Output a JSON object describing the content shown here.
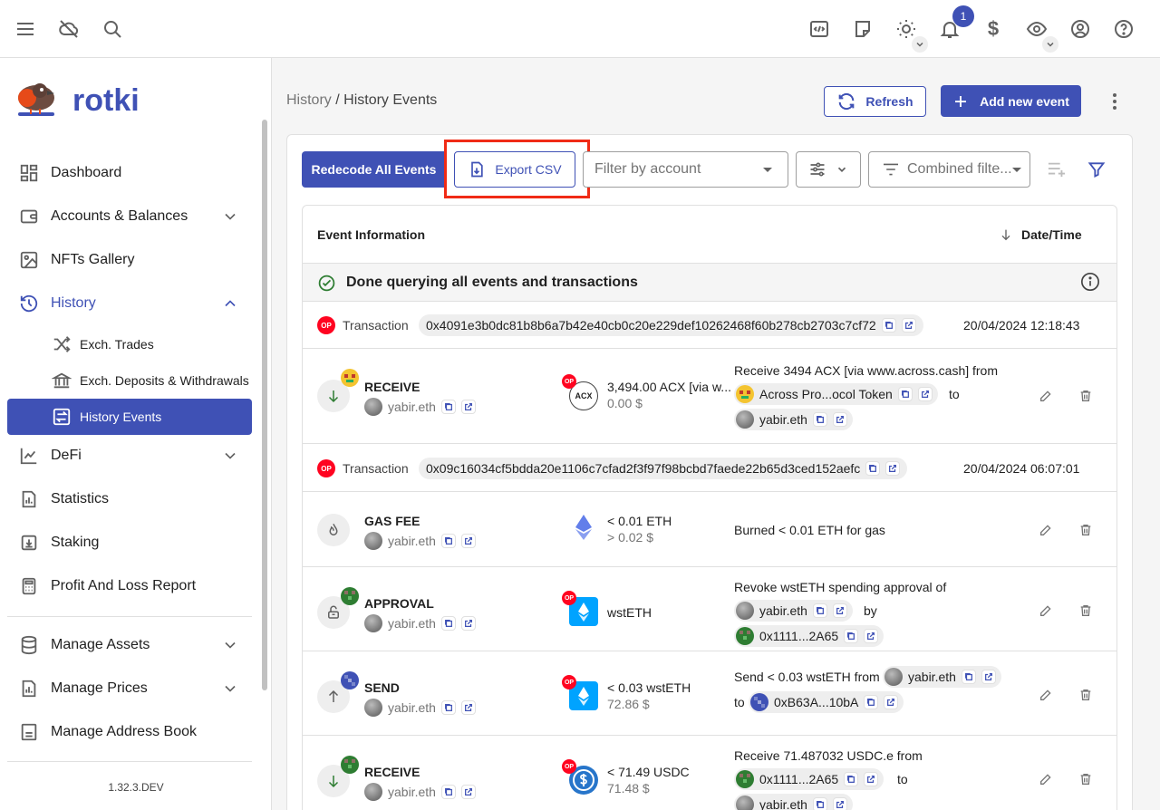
{
  "topbar": {
    "notification_count": "1",
    "currency_symbol": "$",
    "icons": [
      "menu-icon",
      "cloud-off-icon",
      "search-icon",
      "code-icon",
      "note-icon",
      "sun-icon",
      "bell-icon",
      "currency-icon",
      "eye-icon",
      "account-icon",
      "help-icon"
    ]
  },
  "sidebar": {
    "brand": "rotki",
    "items": [
      {
        "label": "Dashboard"
      },
      {
        "label": "Accounts & Balances"
      },
      {
        "label": "NFTs Gallery"
      },
      {
        "label": "History"
      },
      {
        "label": "Exch. Trades"
      },
      {
        "label": "Exch. Deposits & Withdrawals"
      },
      {
        "label": "History Events"
      },
      {
        "label": "DeFi"
      },
      {
        "label": "Statistics"
      },
      {
        "label": "Staking"
      },
      {
        "label": "Profit And Loss Report"
      },
      {
        "label": "Manage Assets"
      },
      {
        "label": "Manage Prices"
      },
      {
        "label": "Manage Address Book"
      }
    ],
    "version": "1.32.3.DEV"
  },
  "header": {
    "breadcrumb_root": "History",
    "breadcrumb_sep": "/",
    "breadcrumb_current": "History Events",
    "refresh_label": "Refresh",
    "add_label": "Add new event"
  },
  "toolbar": {
    "redecode_label": "Redecode All Events",
    "export_label": "Export CSV",
    "account_placeholder": "Filter by account",
    "combined_placeholder": "Combined filte..."
  },
  "table": {
    "col_event": "Event Information",
    "col_date": "Date/Time",
    "status": "Done querying all events and transactions",
    "transactions": [
      {
        "label": "Transaction",
        "chain": "OP",
        "hash": "0x4091e3b0dc81b8b6a7b42e40cb0c20e229def10262468f60b278cb2703c7cf72",
        "date": "20/04/2024 12:18:43",
        "events": [
          {
            "type": "RECEIVE",
            "account": "yabir.eth",
            "asset_symbol": "ACX",
            "amount": "3,494.00 ACX [via w...",
            "value": "0.00 $",
            "desc_prefix": "Receive 3494 ACX [via www.across.cash] from",
            "from_chip": "Across Pro...ocol Token",
            "to_word": "to",
            "to_chip": "yabir.eth"
          }
        ]
      },
      {
        "label": "Transaction",
        "chain": "OP",
        "hash": "0x09c16034cf5bdda20e1106c7cfad2f3f97f98bcbd7faede22b65d3ced152aefc",
        "date": "20/04/2024 06:07:01",
        "events": [
          {
            "type": "GAS FEE",
            "account": "yabir.eth",
            "amount": "< 0.01 ETH",
            "value": "> 0.02 $",
            "desc": "Burned < 0.01 ETH for gas"
          },
          {
            "type": "APPROVAL",
            "account": "yabir.eth",
            "amount": "wstETH",
            "desc_prefix": "Revoke wstETH spending approval of",
            "chip1": "yabir.eth",
            "by_word": "by",
            "chip2": "0x1111...2A65"
          },
          {
            "type": "SEND",
            "account": "yabir.eth",
            "amount": "< 0.03 wstETH",
            "value": "72.86 $",
            "desc_prefix": "Send < 0.03 wstETH from",
            "chip1": "yabir.eth",
            "to_word": "to",
            "chip2": "0xB63A...10bA"
          },
          {
            "type": "RECEIVE",
            "account": "yabir.eth",
            "amount": "< 71.49 USDC",
            "value": "71.48 $",
            "desc_prefix": "Receive 71.487032 USDC.e from",
            "chip1": "0x1111...2A65",
            "to_word": "to",
            "chip2": "yabir.eth"
          }
        ]
      }
    ]
  },
  "colors": {
    "primary": "#3f51b5",
    "highlight": "#f02b16",
    "optimism": "#ff0420",
    "success": "#2e7d32"
  }
}
